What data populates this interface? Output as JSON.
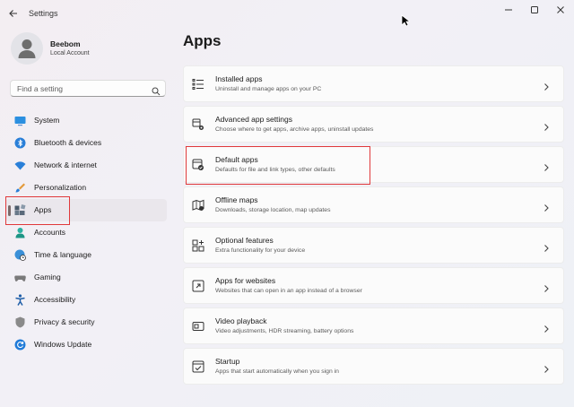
{
  "window": {
    "title": "Settings"
  },
  "profile": {
    "name": "Beebom",
    "account_type": "Local Account"
  },
  "search": {
    "placeholder": "Find a setting"
  },
  "sidebar": {
    "items": [
      {
        "label": "System",
        "icon": "monitor-icon"
      },
      {
        "label": "Bluetooth & devices",
        "icon": "bluetooth-icon"
      },
      {
        "label": "Network & internet",
        "icon": "wifi-icon"
      },
      {
        "label": "Personalization",
        "icon": "brush-icon"
      },
      {
        "label": "Apps",
        "icon": "apps-icon",
        "selected": true
      },
      {
        "label": "Accounts",
        "icon": "person-icon"
      },
      {
        "label": "Time & language",
        "icon": "globe-clock-icon"
      },
      {
        "label": "Gaming",
        "icon": "gamepad-icon"
      },
      {
        "label": "Accessibility",
        "icon": "accessibility-icon"
      },
      {
        "label": "Privacy & security",
        "icon": "shield-icon"
      },
      {
        "label": "Windows Update",
        "icon": "update-icon"
      }
    ]
  },
  "main": {
    "title": "Apps",
    "cards": [
      {
        "title": "Installed apps",
        "description": "Uninstall and manage apps on your PC",
        "icon": "list-icon"
      },
      {
        "title": "Advanced app settings",
        "description": "Choose where to get apps, archive apps, uninstall updates",
        "icon": "app-settings-icon"
      },
      {
        "title": "Default apps",
        "description": "Defaults for file and link types, other defaults",
        "icon": "default-apps-icon"
      },
      {
        "title": "Offline maps",
        "description": "Downloads, storage location, map updates",
        "icon": "map-icon"
      },
      {
        "title": "Optional features",
        "description": "Extra functionality for your device",
        "icon": "optional-features-icon"
      },
      {
        "title": "Apps for websites",
        "description": "Websites that can open in an app instead of a browser",
        "icon": "open-in-app-icon"
      },
      {
        "title": "Video playback",
        "description": "Video adjustments, HDR streaming, battery options",
        "icon": "video-icon"
      },
      {
        "title": "Startup",
        "description": "Apps that start automatically when you sign in",
        "icon": "startup-icon"
      }
    ]
  },
  "colors": {
    "accent": "#0067c0",
    "highlight_box": "#e0393b"
  }
}
